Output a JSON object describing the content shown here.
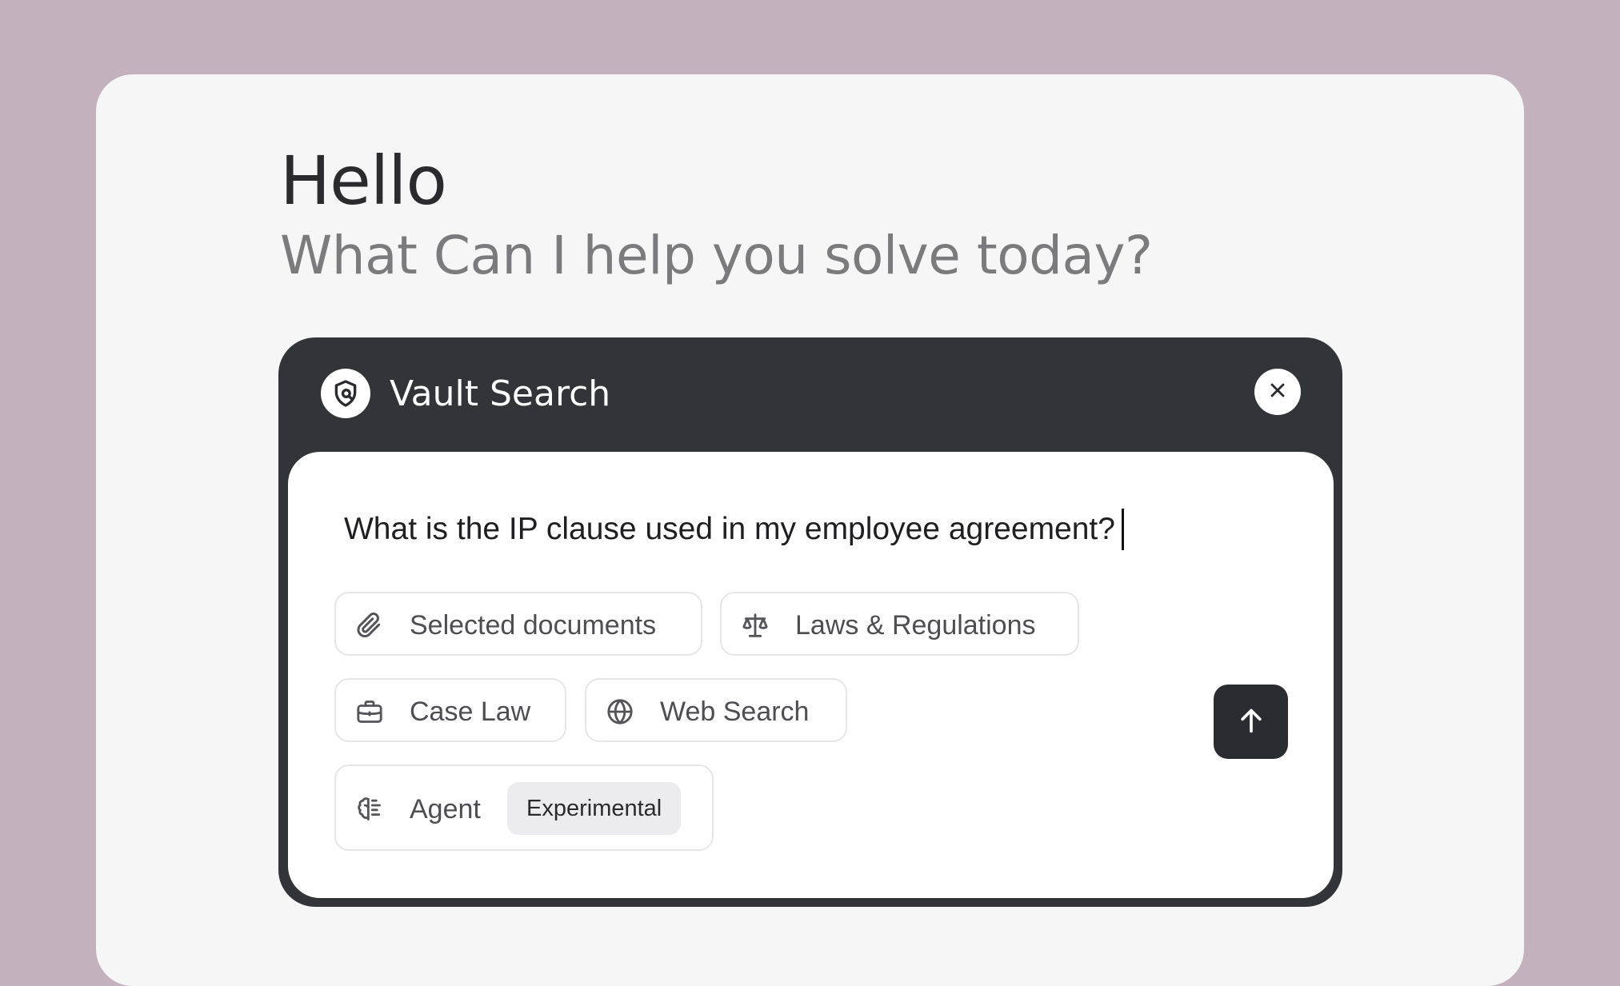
{
  "greeting": {
    "title": "Hello",
    "subtitle": "What Can I help you solve today?"
  },
  "card": {
    "title": "Vault Search",
    "icon": "shield-search-icon",
    "close_icon": "close-icon",
    "query_value": "What is the IP clause used in my employee agreement?",
    "options": [
      {
        "label": "Selected documents",
        "icon": "paperclip-icon"
      },
      {
        "label": "Laws & Regulations",
        "icon": "scales-icon"
      },
      {
        "label": "Case Law",
        "icon": "briefcase-icon"
      },
      {
        "label": "Web Search",
        "icon": "globe-icon"
      },
      {
        "label": "Agent",
        "icon": "brain-icon",
        "badge": "Experimental"
      }
    ],
    "send_icon": "arrow-up-icon"
  },
  "colors": {
    "background": "#c3b1bc",
    "panel": "#f6f6f6",
    "card_dark": "#333438",
    "send_button": "#2b2c30",
    "badge_bg": "#ececee"
  }
}
